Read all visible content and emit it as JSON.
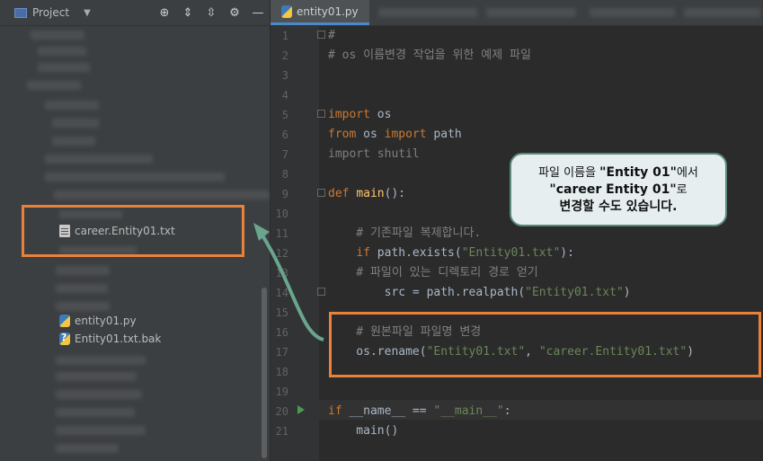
{
  "project_panel": {
    "title": "Project",
    "tools": [
      "⊕",
      "⇕",
      "⇳",
      "⚙",
      "—"
    ],
    "items": [
      {
        "label": "career.Entity01.txt",
        "icon": "text-file-icon"
      },
      {
        "label": "entity01.py",
        "icon": "python-file-icon"
      },
      {
        "label": "Entity01.txt.bak",
        "icon": "unknown-file-icon"
      }
    ]
  },
  "editor": {
    "tab_label": "entity01.py",
    "line_numbers": [
      "1",
      "2",
      "3",
      "4",
      "5",
      "6",
      "7",
      "8",
      "9",
      "10",
      "11",
      "12",
      "13",
      "14",
      "15",
      "16",
      "17",
      "18",
      "19",
      "20",
      "21"
    ],
    "lines": [
      {
        "parts": [
          {
            "t": "#",
            "c": "cm"
          }
        ]
      },
      {
        "parts": [
          {
            "t": "# os 이름변경 작업을 위한 예제 파일",
            "c": "cm"
          }
        ]
      },
      {
        "parts": []
      },
      {
        "parts": []
      },
      {
        "parts": [
          {
            "t": "import",
            "c": "kw"
          },
          {
            "t": " os",
            "c": ""
          }
        ]
      },
      {
        "parts": [
          {
            "t": "from",
            "c": "kw"
          },
          {
            "t": " os ",
            "c": ""
          },
          {
            "t": "import",
            "c": "kw"
          },
          {
            "t": " path",
            "c": ""
          }
        ]
      },
      {
        "parts": [
          {
            "t": "import shutil",
            "c": "dim"
          }
        ]
      },
      {
        "parts": []
      },
      {
        "parts": [
          {
            "t": "def ",
            "c": "kw"
          },
          {
            "t": "main",
            "c": "fn"
          },
          {
            "t": "():",
            "c": ""
          }
        ]
      },
      {
        "parts": []
      },
      {
        "parts": [
          {
            "t": "    # 기존파일 복제합니다.",
            "c": "cm"
          }
        ]
      },
      {
        "parts": [
          {
            "t": "    ",
            "c": ""
          },
          {
            "t": "if",
            "c": "kw"
          },
          {
            "t": " path.exists(",
            "c": ""
          },
          {
            "t": "\"Entity01.txt\"",
            "c": "str"
          },
          {
            "t": "):",
            "c": ""
          }
        ]
      },
      {
        "parts": [
          {
            "t": "    # 파일이 있는 디렉토리 경로 얻기",
            "c": "cm"
          }
        ]
      },
      {
        "parts": [
          {
            "t": "        src = path.realpath(",
            "c": ""
          },
          {
            "t": "\"Entity01.txt\"",
            "c": "str"
          },
          {
            "t": ")",
            "c": ""
          }
        ]
      },
      {
        "parts": []
      },
      {
        "parts": [
          {
            "t": "    # 원본파일 파일명 변경",
            "c": "cm"
          }
        ]
      },
      {
        "parts": [
          {
            "t": "    os.rename(",
            "c": ""
          },
          {
            "t": "\"Entity01.txt\"",
            "c": "str"
          },
          {
            "t": ", ",
            "c": ""
          },
          {
            "t": "\"career.Entity01.txt\"",
            "c": "str"
          },
          {
            "t": ")",
            "c": ""
          }
        ]
      },
      {
        "parts": []
      },
      {
        "parts": []
      },
      {
        "parts": [
          {
            "t": "if",
            "c": "kw"
          },
          {
            "t": " __name__ == ",
            "c": ""
          },
          {
            "t": "\"__main__\"",
            "c": "str"
          },
          {
            "t": ":",
            "c": ""
          }
        ]
      },
      {
        "parts": [
          {
            "t": "    main()",
            "c": ""
          }
        ]
      }
    ]
  },
  "callout": {
    "line1_pre": "파일 이름을 ",
    "line1_bold": "\"Entity 01\"",
    "line1_post": "에서",
    "line2_bold": "\"career Entity 01\"",
    "line2_post": "로",
    "line3": "변경할 수도 있습니다."
  },
  "colors": {
    "highlight_box": "#e8823a",
    "arrow": "#6aa58d",
    "keyword": "#cc7832",
    "string": "#6a8759"
  }
}
